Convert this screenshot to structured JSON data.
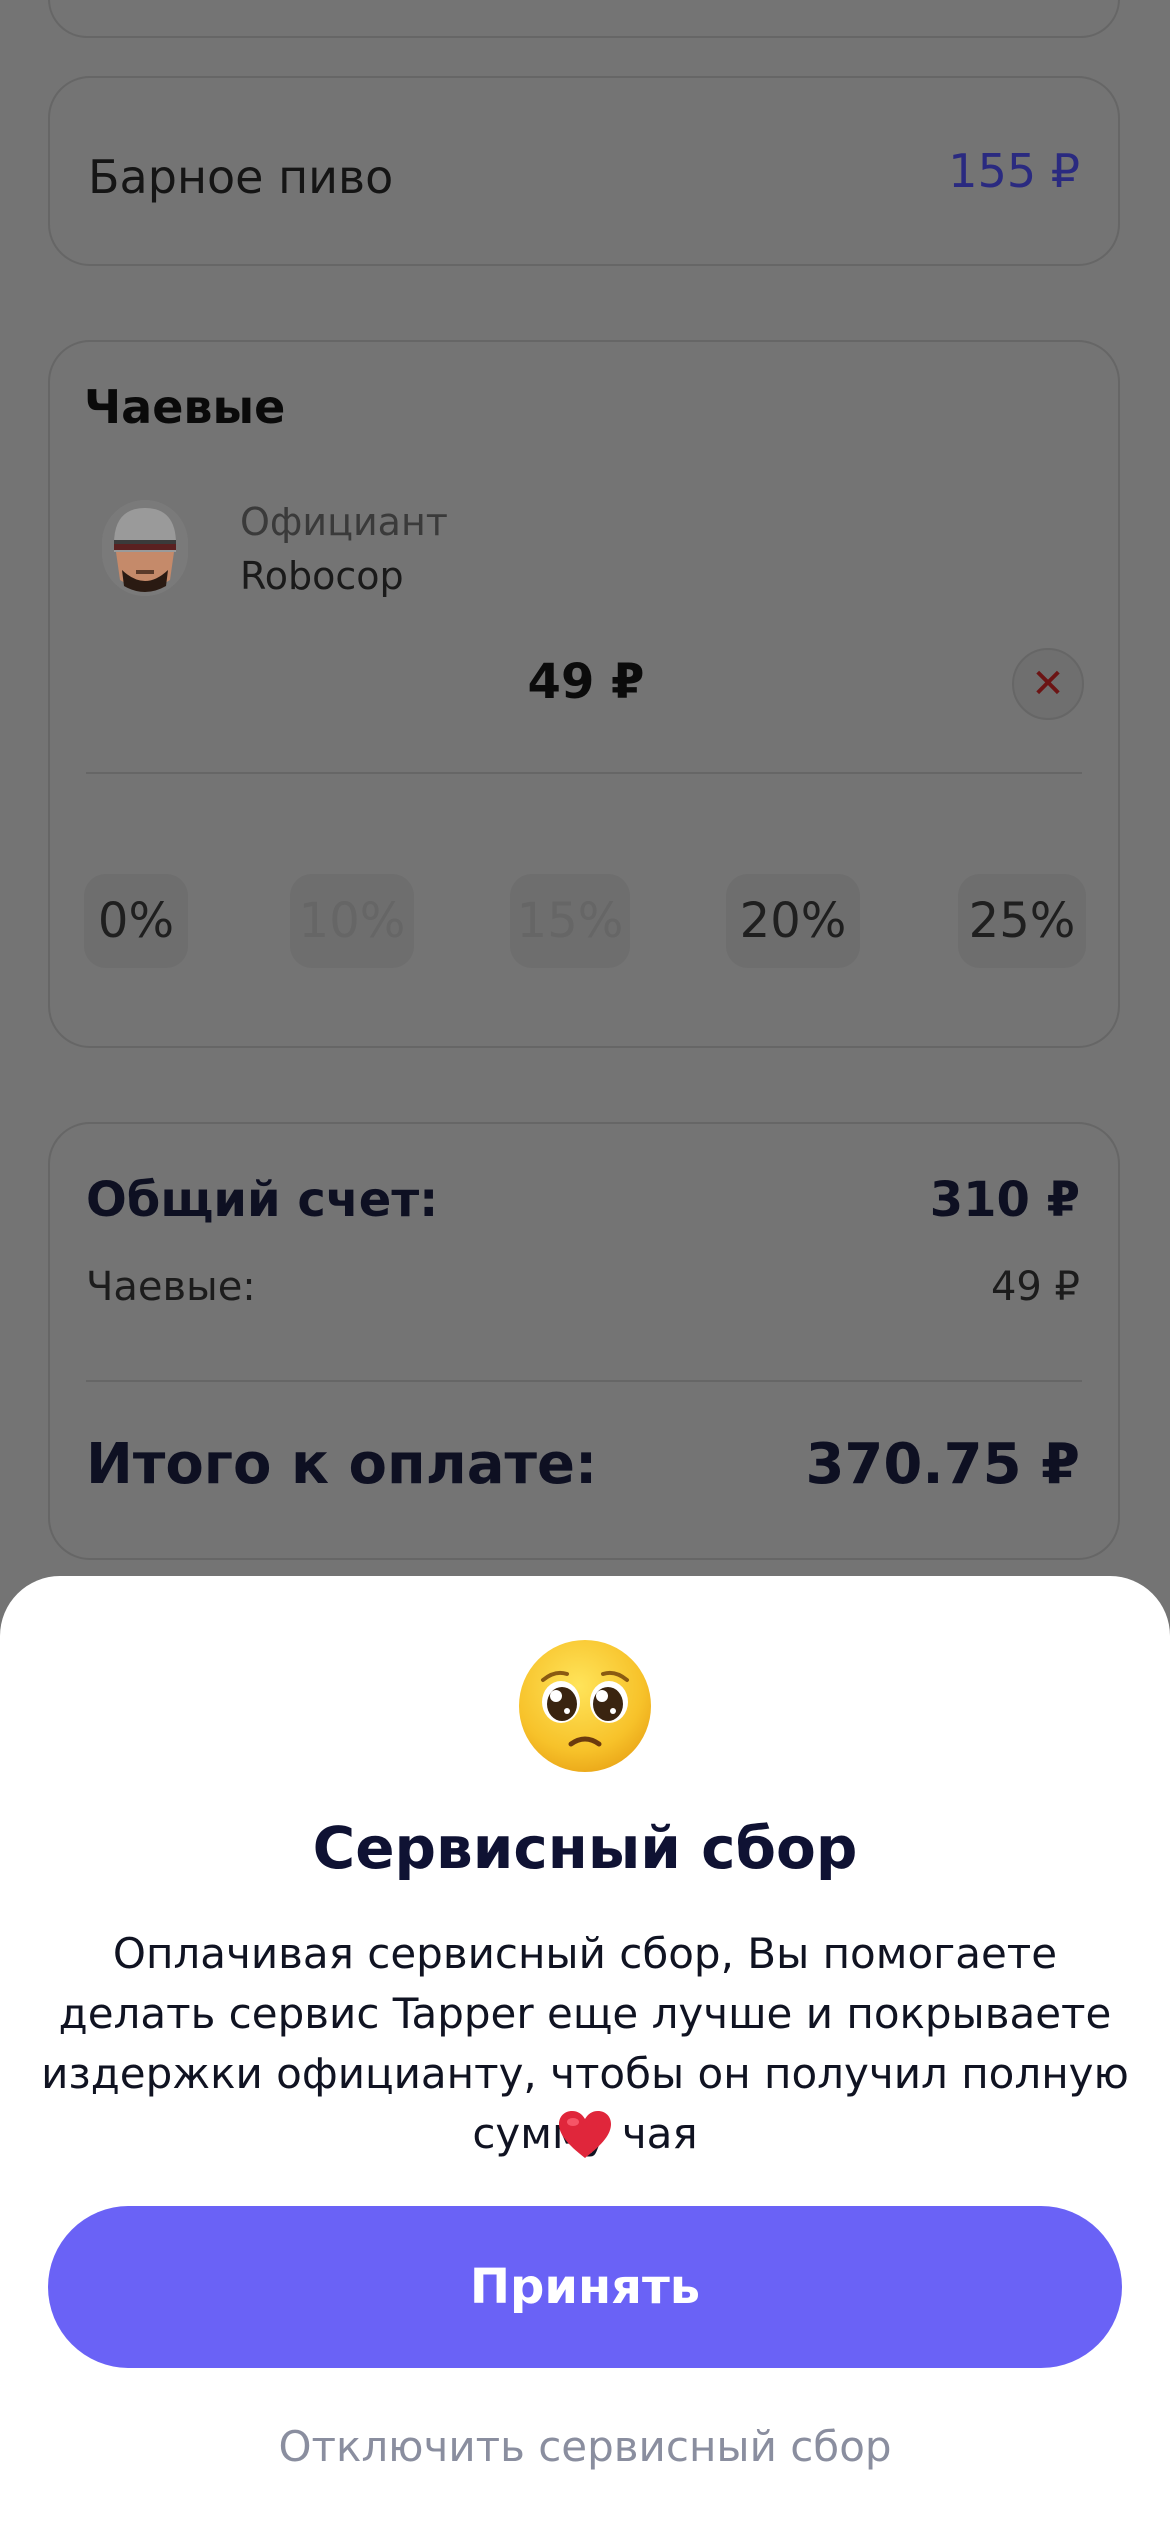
{
  "order": {
    "item_name": "Барное пиво",
    "item_price": "155 ₽"
  },
  "tips": {
    "title": "Чаевые",
    "waiter_role": "Официант",
    "waiter_name": "Robocop",
    "amount": "49 ₽",
    "clear_icon": "close-icon",
    "percent_options": [
      {
        "label": "0%",
        "enabled": true
      },
      {
        "label": "10%",
        "enabled": false
      },
      {
        "label": "15%",
        "enabled": false
      },
      {
        "label": "20%",
        "enabled": true
      },
      {
        "label": "25%",
        "enabled": true
      }
    ]
  },
  "summary": {
    "bill_label": "Общий счет:",
    "bill_value": "310 ₽",
    "tips_label": "Чаевые:",
    "tips_value": "49 ₽",
    "total_label": "Итого к оплате:",
    "total_value": "370.75 ₽"
  },
  "sheet": {
    "emoji_icon": "pleading-face-emoji",
    "title": "Сервисный сбор",
    "body": "Оплачивая сервисный сбор, Вы помогаете делать сервис Tapper еще лучше и покрываете издержки официанту, чтобы он получил полную сумму чая",
    "heart_icon": "red-heart-emoji",
    "accept_label": "Принять",
    "disable_label": "Отключить сервисный сбор"
  },
  "colors": {
    "accent": "#6a62f6",
    "overlay": "#747474",
    "price": "#2a2a80",
    "muted_link": "#8a8e9f"
  }
}
